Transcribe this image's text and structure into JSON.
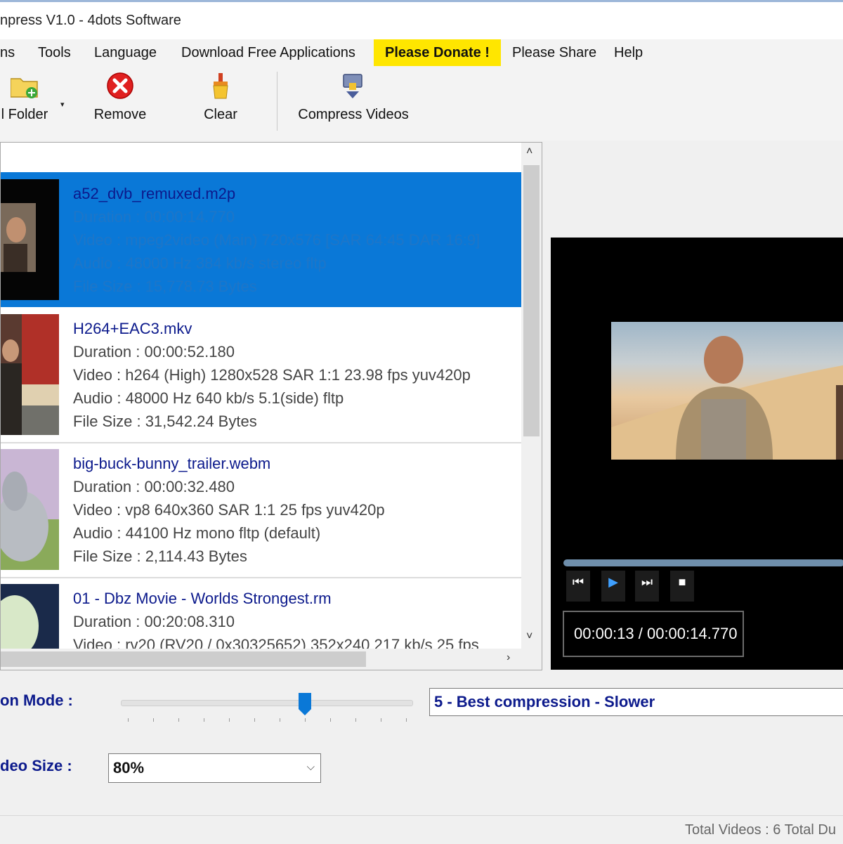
{
  "window": {
    "title": "npress V1.0 - 4dots Software"
  },
  "menu": {
    "items": [
      "ns",
      "Tools",
      "Language",
      "Download Free Applications",
      "Please Donate !",
      "Please Share",
      "Help"
    ]
  },
  "toolbar": {
    "add_folder": "l Folder",
    "remove": "Remove",
    "clear": "Clear",
    "compress": "Compress Videos",
    "dropdown_glyph": "▾"
  },
  "videos": [
    {
      "name": "a52_dvb_remuxed.m2p",
      "duration": "Duration : 00:00:14.770",
      "video": "Video : mpeg2video (Main) 720x576 [SAR 64:45 DAR 16:9]",
      "audio": "Audio :  48000 Hz 384 kb/s stereo fltp",
      "size": "File Size : 15,778.73 Bytes",
      "selected": true
    },
    {
      "name": "H264+EAC3.mkv",
      "duration": "Duration : 00:00:52.180",
      "video": "Video : h264 (High) 1280x528 SAR 1:1 23.98 fps yuv420p",
      "audio": "Audio :  48000 Hz 640 kb/s 5.1(side) fltp",
      "size": "File Size : 31,542.24 Bytes",
      "selected": false
    },
    {
      "name": "big-buck-bunny_trailer.webm",
      "duration": "Duration : 00:00:32.480",
      "video": "Video : vp8 640x360 SAR 1:1 25 fps yuv420p",
      "audio": "Audio :  44100 Hz  mono fltp (default)",
      "size": "File Size : 2,114.43 Bytes",
      "selected": false
    },
    {
      "name": "01 - Dbz Movie - Worlds Strongest.rm",
      "duration": "Duration : 00:20:08.310",
      "video": "Video : rv20 (RV20 / 0x30325652) 352x240 217 kb/s 25 fps",
      "selected": false
    }
  ],
  "scroll_glyphs": {
    "up": "˄",
    "down": "˅",
    "right": "›"
  },
  "player": {
    "time": "00:00:13 / 00:00:14.770",
    "buttons": {
      "prev": "⏮",
      "play": "▶",
      "next": "⏭",
      "stop": "■"
    }
  },
  "settings": {
    "mode_label": "on Mode :",
    "mode_value": "5 - Best compression - Slower",
    "mode_level": 7,
    "mode_levels": 12,
    "size_label": "deo Size :",
    "size_value": "80%",
    "combo_arrow": "⌵"
  },
  "status": {
    "text": "Total Videos : 6   Total Du"
  },
  "colors": {
    "selection": "#0a78d7",
    "donate": "#ffe600",
    "link_blue": "#0c1a8c"
  }
}
